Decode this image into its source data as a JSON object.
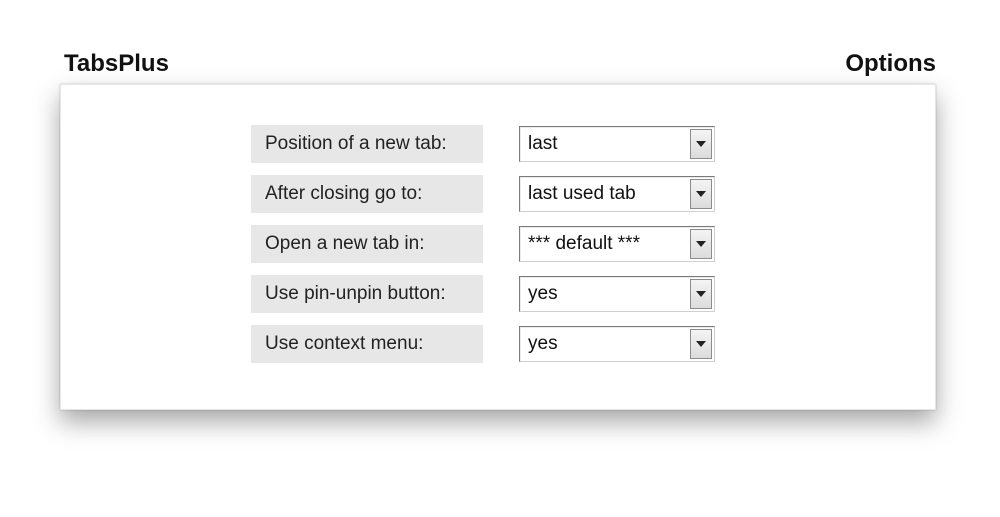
{
  "header": {
    "title_left": "TabsPlus",
    "title_right": "Options"
  },
  "options": {
    "position_new_tab": {
      "label": "Position of a new tab:",
      "value": "last"
    },
    "after_closing": {
      "label": "After closing go to:",
      "value": "last used tab"
    },
    "open_new_tab_in": {
      "label": "Open a new tab in:",
      "value": "*** default ***"
    },
    "use_pin_unpin": {
      "label": "Use pin-unpin button:",
      "value": "yes"
    },
    "use_context_menu": {
      "label": "Use context menu:",
      "value": "yes"
    }
  }
}
